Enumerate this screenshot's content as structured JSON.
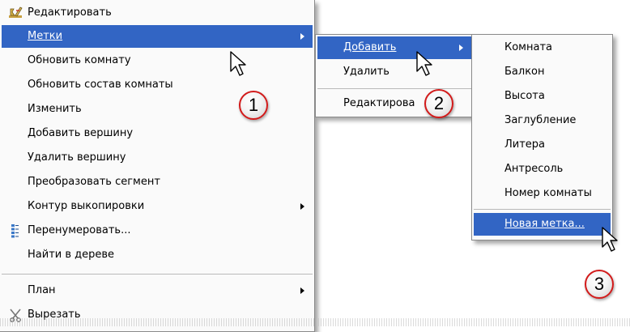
{
  "main_menu": {
    "items": [
      {
        "label": "Редактировать"
      },
      {
        "label": "Метки"
      },
      {
        "label": "Обновить комнату"
      },
      {
        "label": "Обновить состав комнаты"
      },
      {
        "label": "Изменить"
      },
      {
        "label": "Добавить вершину"
      },
      {
        "label": "Удалить вершину"
      },
      {
        "label": "Преобразовать сегмент"
      },
      {
        "label": "Контур выкопировки"
      },
      {
        "label": "Перенумеровать..."
      },
      {
        "label": "Найти в дереве"
      },
      {
        "label": "План"
      },
      {
        "label": "Вырезать"
      }
    ]
  },
  "labels_submenu": {
    "items": [
      {
        "label": "Добавить"
      },
      {
        "label": "Удалить"
      },
      {
        "label": "Редактирова"
      }
    ]
  },
  "add_submenu": {
    "items": [
      {
        "label": "Комната"
      },
      {
        "label": "Балкон"
      },
      {
        "label": "Высота"
      },
      {
        "label": "Заглубление"
      },
      {
        "label": "Литера"
      },
      {
        "label": "Антресоль"
      },
      {
        "label": "Номер комнаты"
      },
      {
        "label": "Новая метка..."
      }
    ]
  },
  "callouts": {
    "one": "1",
    "two": "2",
    "three": "3"
  },
  "colors": {
    "highlight": "#3265c4",
    "callout_border": "#d21a1a"
  },
  "icons": [
    "edit-icon",
    "renumber-icon",
    "cut-icon",
    "mouse-cursor-icon"
  ]
}
